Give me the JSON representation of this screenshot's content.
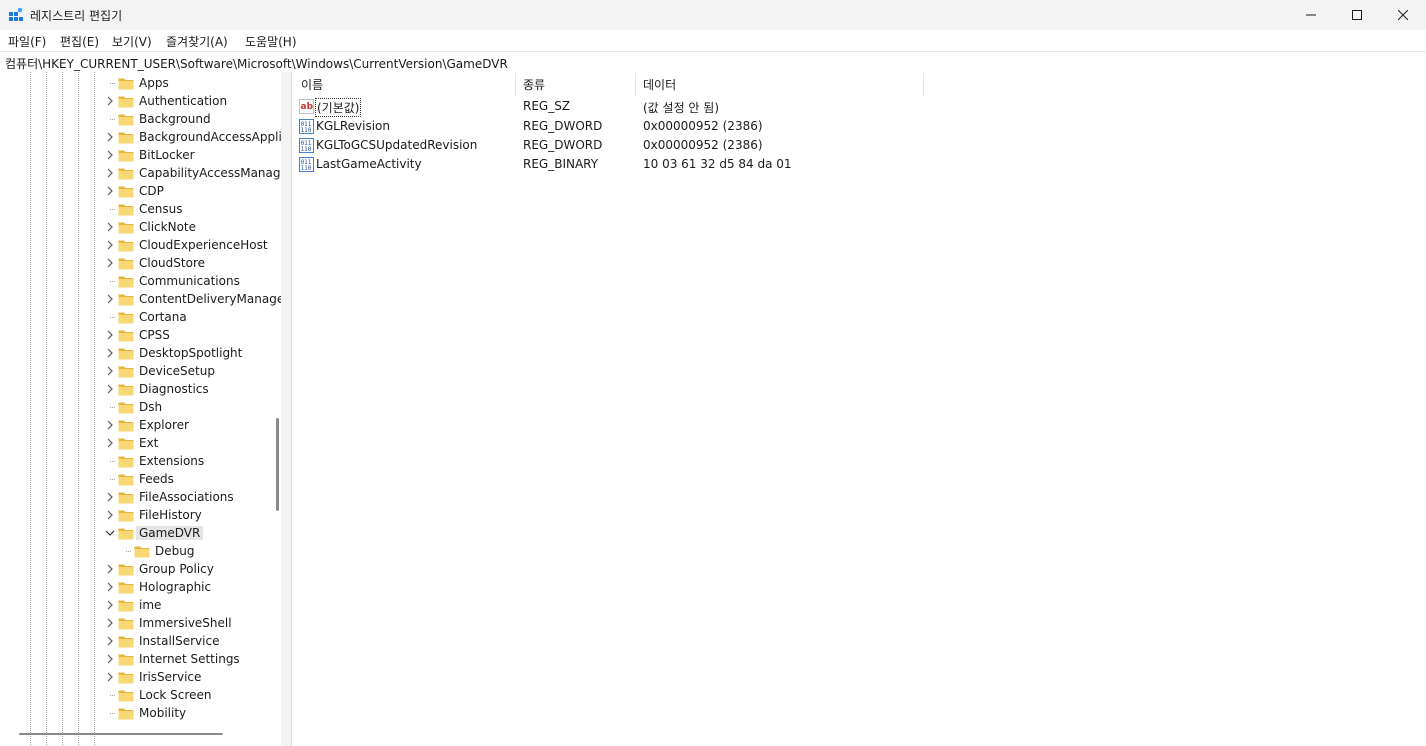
{
  "window": {
    "title": "레지스트리 편집기",
    "minimize_glyph": "—",
    "maximize_glyph": "☐",
    "close_glyph": "✕"
  },
  "menu": [
    "파일(F)",
    "편집(E)",
    "보기(V)",
    "즐겨찾기(A)",
    "도움말(H)"
  ],
  "address": "컴퓨터\\HKEY_CURRENT_USER\\Software\\Microsoft\\Windows\\CurrentVersion\\GameDVR",
  "tree": {
    "items": [
      {
        "label": "Apps",
        "expander": false
      },
      {
        "label": "Authentication",
        "expander": true
      },
      {
        "label": "Background",
        "expander": false
      },
      {
        "label": "BackgroundAccessApplic",
        "expander": true
      },
      {
        "label": "BitLocker",
        "expander": true
      },
      {
        "label": "CapabilityAccessManage",
        "expander": true
      },
      {
        "label": "CDP",
        "expander": true
      },
      {
        "label": "Census",
        "expander": false
      },
      {
        "label": "ClickNote",
        "expander": true
      },
      {
        "label": "CloudExperienceHost",
        "expander": true
      },
      {
        "label": "CloudStore",
        "expander": true
      },
      {
        "label": "Communications",
        "expander": false
      },
      {
        "label": "ContentDeliveryManage",
        "expander": true
      },
      {
        "label": "Cortana",
        "expander": false
      },
      {
        "label": "CPSS",
        "expander": true
      },
      {
        "label": "DesktopSpotlight",
        "expander": true
      },
      {
        "label": "DeviceSetup",
        "expander": true
      },
      {
        "label": "Diagnostics",
        "expander": true
      },
      {
        "label": "Dsh",
        "expander": false
      },
      {
        "label": "Explorer",
        "expander": true
      },
      {
        "label": "Ext",
        "expander": true
      },
      {
        "label": "Extensions",
        "expander": false
      },
      {
        "label": "Feeds",
        "expander": false
      },
      {
        "label": "FileAssociations",
        "expander": true
      },
      {
        "label": "FileHistory",
        "expander": true
      },
      {
        "label": "GameDVR",
        "expander": "open",
        "selected": true
      },
      {
        "label": "Debug",
        "expander": false,
        "child": true
      },
      {
        "label": "Group Policy",
        "expander": true
      },
      {
        "label": "Holographic",
        "expander": true
      },
      {
        "label": "ime",
        "expander": true
      },
      {
        "label": "ImmersiveShell",
        "expander": true
      },
      {
        "label": "InstallService",
        "expander": true
      },
      {
        "label": "Internet Settings",
        "expander": true
      },
      {
        "label": "IrisService",
        "expander": true
      },
      {
        "label": "Lock Screen",
        "expander": false
      },
      {
        "label": "Mobility",
        "expander": false
      }
    ]
  },
  "list": {
    "columns": [
      "이름",
      "종류",
      "데이터"
    ],
    "rows": [
      {
        "name": "(기본값)",
        "type": "REG_SZ",
        "data": "(값 설정 안 됨)",
        "icon": "string-value-icon"
      },
      {
        "name": "KGLRevision",
        "type": "REG_DWORD",
        "data": "0x00000952 (2386)",
        "icon": "binary-value-icon"
      },
      {
        "name": "KGLToGCSUpdatedRevision",
        "type": "REG_DWORD",
        "data": "0x00000952 (2386)",
        "icon": "binary-value-icon"
      },
      {
        "name": "LastGameActivity",
        "type": "REG_BINARY",
        "data": "10 03 61 32 d5 84 da 01",
        "icon": "binary-value-icon"
      }
    ]
  },
  "colors": {
    "folder": "#f8d775",
    "folder_dark": "#e6b53c",
    "selection": "#e5e5e5",
    "chrome_bg": "#f3f3f3"
  }
}
